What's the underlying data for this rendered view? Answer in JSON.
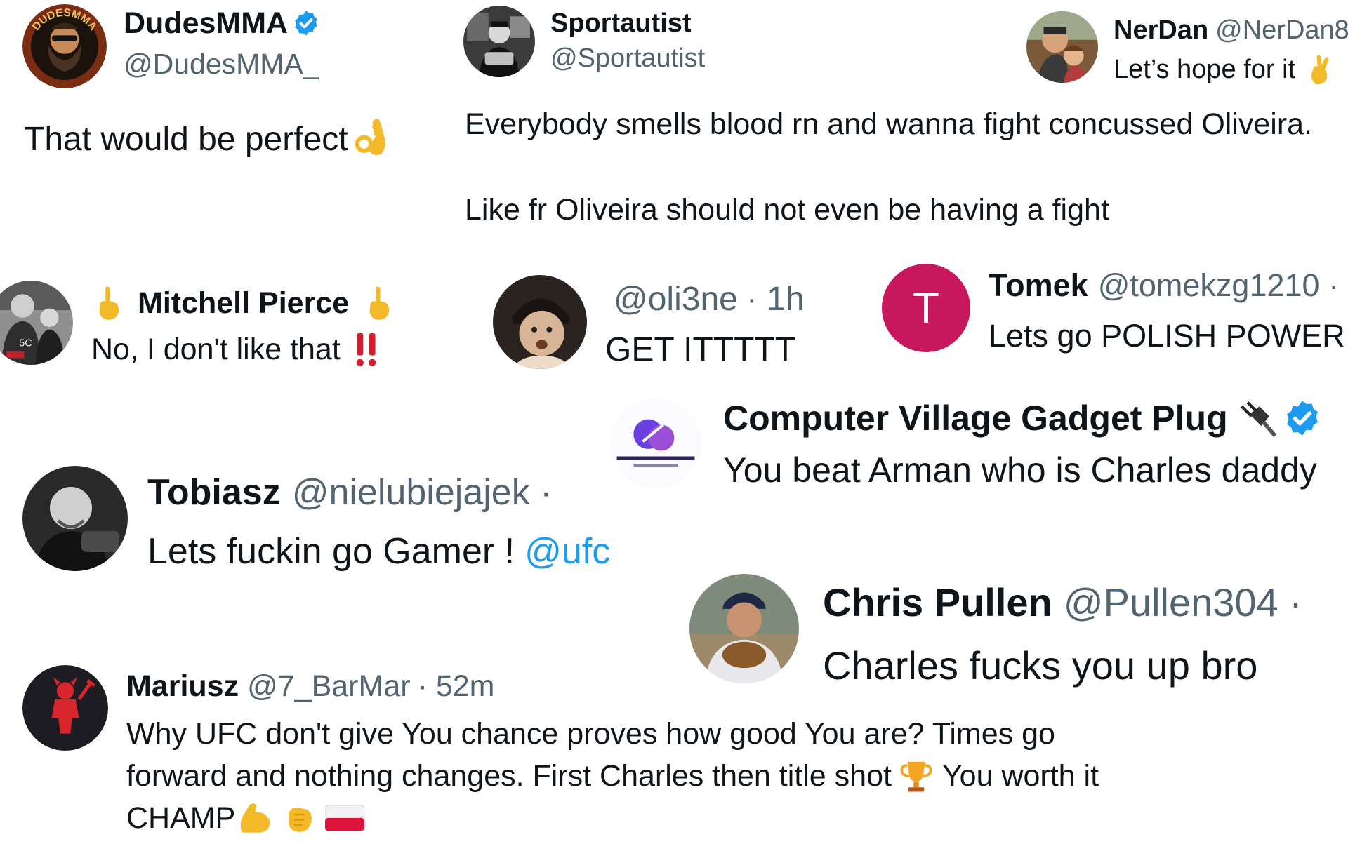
{
  "colors": {
    "name": "#0f1419",
    "handle": "#536471",
    "link": "#1d9bf0",
    "verified": "#1d9bf0",
    "tomek_avatar_bg": "#c8175f"
  },
  "tweets": [
    {
      "id": "dudesmma",
      "name": "DudesMMA",
      "handle": "@DudesMMA_",
      "avatar_icon": "dudesmma-logo-avatar",
      "avatar_text": "DUDESMMA",
      "verified": true,
      "text": "That would be perfect",
      "emoji": "ok-hand-emoji"
    },
    {
      "id": "sportautist",
      "name": "Sportautist",
      "handle": "@Sportautist",
      "avatar_icon": "photo-avatar",
      "text_lines": [
        "Everybody smells blood rn and wanna fight concussed Oliveira.",
        "Like fr Oliveira should not even be having a fight"
      ]
    },
    {
      "id": "nerdan",
      "name": "NerDan",
      "handle": "@NerDan8",
      "avatar_icon": "photo-avatar",
      "text": "Let’s hope for it",
      "emoji": "crossed-fingers-emoji"
    },
    {
      "id": "mitchell",
      "name": "Mitchell Pierce",
      "avatar_icon": "photo-avatar",
      "text": "No, I don't like that",
      "emoji_left": "pointing-up-emoji",
      "emoji_right": "pointing-up-emoji",
      "emoji_text": "double-exclamation-emoji"
    },
    {
      "id": "oli3ne",
      "handle": "@oli3ne",
      "time": "· 1h",
      "avatar_icon": "photo-avatar",
      "text": "GET ITTTTT"
    },
    {
      "id": "tomek",
      "name": "Tomek",
      "handle": "@tomekzg1210 ·",
      "avatar_letter": "T",
      "text": "Lets go POLISH POWER"
    },
    {
      "id": "cvgp",
      "name": "Computer Village Gadget Plug",
      "avatar_icon": "gadget-logo-avatar",
      "verified": true,
      "name_emoji": "electric-plug-emoji",
      "text": "You beat Arman who is Charles daddy"
    },
    {
      "id": "tobiasz",
      "name": "Tobiasz",
      "handle": "@nielubiejajek ·",
      "avatar_icon": "photo-avatar",
      "text": "Lets fuckin go Gamer !",
      "mention": "@ufc"
    },
    {
      "id": "pullen",
      "name": "Chris Pullen",
      "handle": "@Pullen304 ·",
      "avatar_icon": "photo-avatar",
      "text": "Charles fucks you up bro"
    },
    {
      "id": "mariusz",
      "name": "Mariusz",
      "handle": "@7_BarMar",
      "time": "· 52m",
      "avatar_icon": "devil-logo-avatar",
      "text_lines": [
        "Why UFC don't give You chance proves how good You are? Times go",
        "forward and nothing changes. First Charles then title shot",
        "You worth it",
        "CHAMP"
      ],
      "emojis": [
        "trophy-emoji",
        "flexed-biceps-emoji",
        "fist-bump-emoji",
        "poland-flag-emoji"
      ]
    }
  ]
}
